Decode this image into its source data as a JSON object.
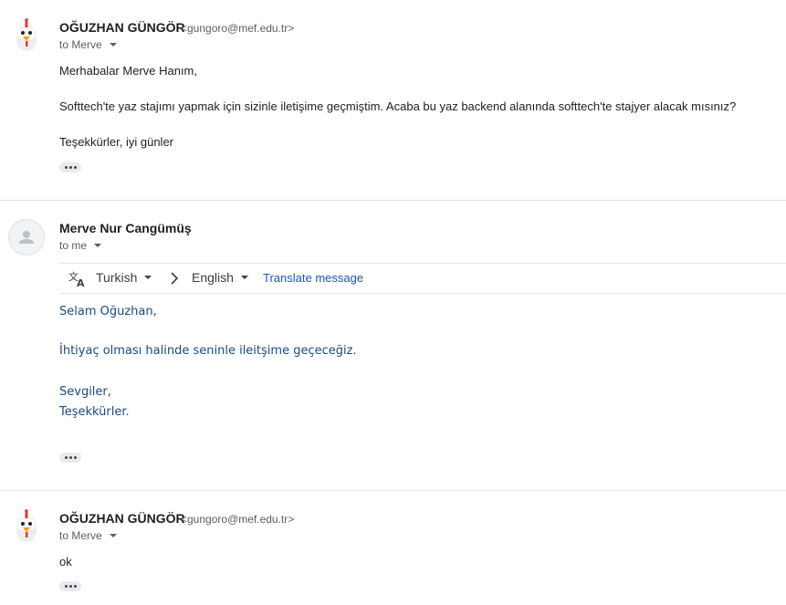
{
  "messages": [
    {
      "sender": "OĞUZHAN GÜNGÖR",
      "email": "<gungoro@mef.edu.tr>",
      "recipient": "to Merve",
      "lines": [
        "Merhabalar Merve Hanım,",
        "Softtech'te yaz stajımı yapmak için sizinle iletişime geçmiştim. Acaba bu yaz backend alanında softtech'te stajyer alacak mısınız?",
        "Teşekkürler, iyi günler"
      ]
    },
    {
      "sender": "Merve Nur Cangümüş",
      "recipient": "to me",
      "translate": {
        "source_lang": "Turkish",
        "target_lang": "English",
        "link": "Translate message"
      },
      "lines": [
        "Selam Oğuzhan,",
        "İhtiyaç olması halinde seninle ileitşime geçeceğiz.",
        "Sevgiler,",
        "Teşekkürler."
      ]
    },
    {
      "sender": "OĞUZHAN GÜNGÖR",
      "email": "<gungoro@mef.edu.tr>",
      "recipient": "to Merve",
      "lines": [
        "ok"
      ]
    }
  ],
  "icons": {
    "chicken_avatar": "chicken-avatar-icon",
    "default_avatar": "person-avatar-icon",
    "translate": "translate-icon",
    "arrow": "chevron-right-icon",
    "more": "more-horizontal-icon"
  },
  "colors": {
    "link_blue": "#1a56c4",
    "reply_text": "#1a4a82",
    "divider": "#e5e5e5"
  }
}
